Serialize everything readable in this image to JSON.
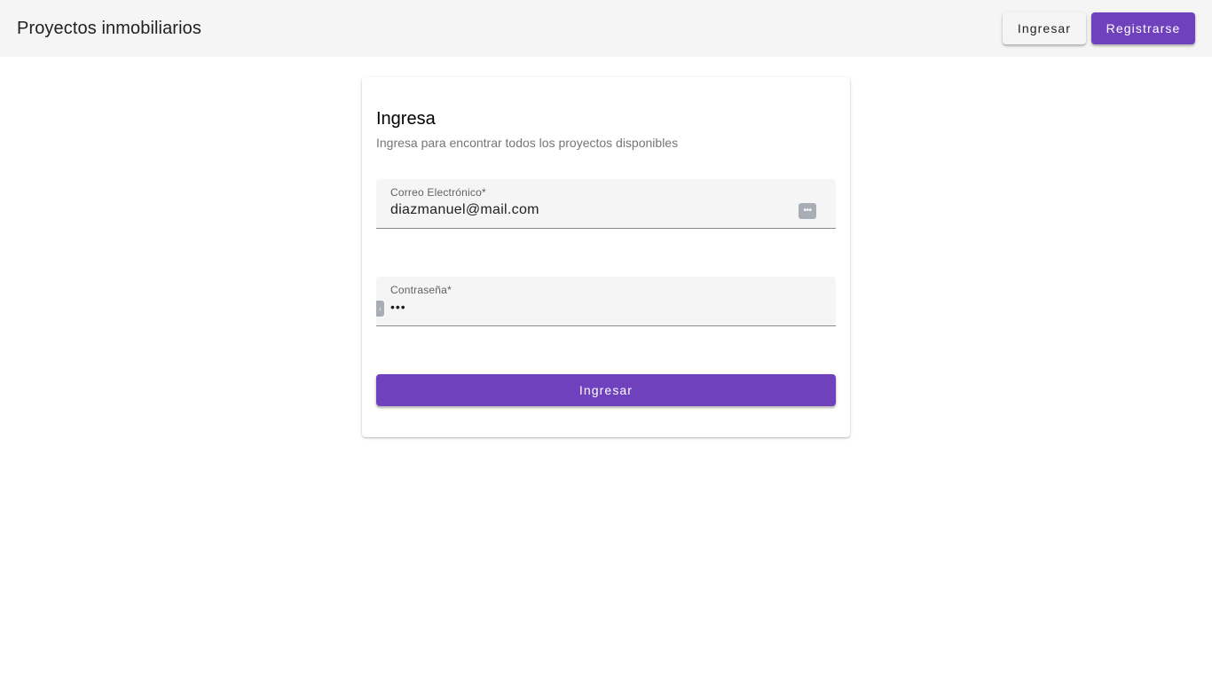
{
  "header": {
    "title": "Proyectos inmobiliarios",
    "login_label": "Ingresar",
    "register_label": "Registrarse"
  },
  "card": {
    "title": "Ingresa",
    "subtitle": "Ingresa para encontrar todos los proyectos disponibles",
    "email": {
      "label": "Correo Electrónico*",
      "value": "diazmanuel@mail.com"
    },
    "password": {
      "label": "Contraseña*",
      "value": "•••"
    },
    "submit_label": "Ingresar"
  },
  "colors": {
    "primary": "#6f41bd",
    "toolbar": "#f5f5f5"
  }
}
